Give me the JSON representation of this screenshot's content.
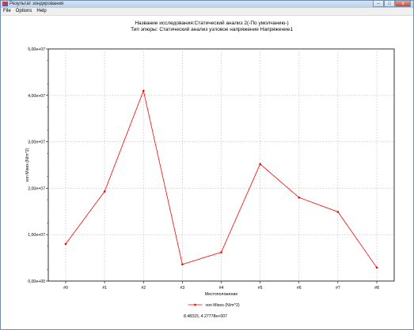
{
  "window": {
    "title": "Результат зондирования",
    "buttons": {
      "minimize": "–",
      "maximize": "□",
      "close": "x"
    },
    "icon": "app-icon"
  },
  "menu": [
    "File",
    "Options",
    "Help"
  ],
  "chart_data": {
    "type": "line",
    "title": "Название исследования:Статический анализ 2(-По умолчанию-)",
    "subtitle": "Тип эпюры: Статический анализ узловое напряжение Напряжение1",
    "xlabel": "Местоположение",
    "ylabel": "von Mises (N/m^2)",
    "categories": [
      "#0",
      "#1",
      "#2",
      "#3",
      "#4",
      "#5",
      "#6",
      "#7",
      "#8"
    ],
    "series": [
      {
        "name": "von Mises (N/m^2)",
        "color": "#ff0000",
        "values": [
          8000000.0,
          19300000.0,
          41000000.0,
          3600000.0,
          6200000.0,
          25200000.0,
          18000000.0,
          14900000.0,
          2900000.0
        ]
      }
    ],
    "yticks": [
      "0,00e+00",
      "1,00e+07",
      "2,00e+07",
      "3,00e+07",
      "4,00e+07",
      "5,00e+07"
    ],
    "ylim": [
      0,
      50000000
    ],
    "grid": true,
    "legend_position": "bottom-center",
    "coordinate_readout": "8.48315, 4.27778e+007"
  }
}
